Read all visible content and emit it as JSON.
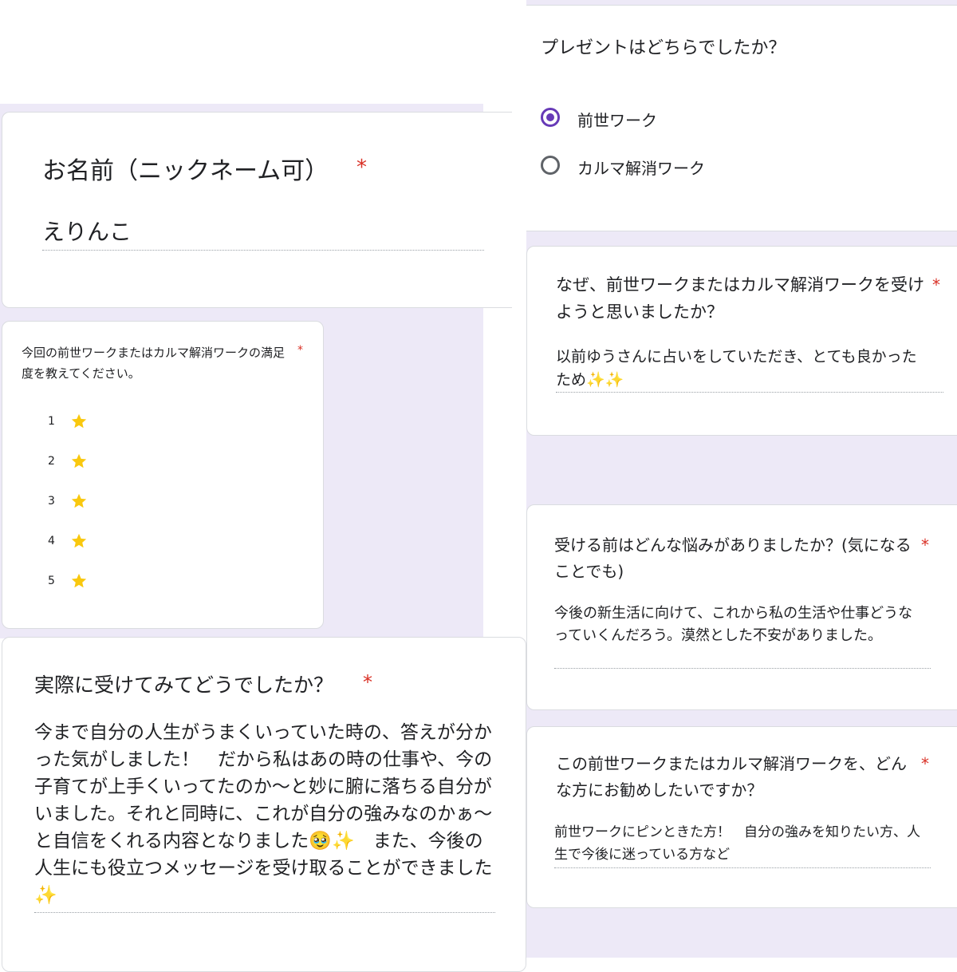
{
  "name_card": {
    "question": "お名前（ニックネーム可）",
    "required_mark": "*",
    "answer": "えりんこ"
  },
  "satisfaction_card": {
    "question": "今回の前世ワークまたはカルマ解消ワークの満足度を教えてください。",
    "required_mark": "*",
    "rows": [
      {
        "label": "1",
        "star_color": "#f9c80e"
      },
      {
        "label": "2",
        "star_color": "#f9c80e"
      },
      {
        "label": "3",
        "star_color": "#f9c80e"
      },
      {
        "label": "4",
        "star_color": "#f9c80e"
      },
      {
        "label": "5",
        "star_color": "#f9c80e"
      }
    ]
  },
  "experience_card": {
    "question": "実際に受けてみてどうでしたか？",
    "required_mark": "*",
    "answer": "今まで自分の人生がうまくいっていた時の、答えが分かった気がしました！　だから私はあの時の仕事や、今の子育てが上手くいってたのか〜と妙に腑に落ちる自分がいました。それと同時に、これが自分の強みなのかぁ〜と自信をくれる内容となりました🥹✨　また、今後の人生にも役立つメッセージを受け取ることができました✨"
  },
  "gift_card": {
    "question": "プレゼントはどちらでしたか？",
    "options": [
      {
        "label": "前世ワーク",
        "selected": true
      },
      {
        "label": "カルマ解消ワーク",
        "selected": false
      }
    ],
    "accent_color": "#673ab7"
  },
  "why_card": {
    "question": "なぜ、前世ワークまたはカルマ解消ワークを受けようと思いましたか？",
    "required_mark": "*",
    "answer": "以前ゆうさんに占いをしていただき、とても良かったため✨✨"
  },
  "worry_card": {
    "question": "受ける前はどんな悩みがありましたか？(気になることでも)",
    "required_mark": "*",
    "answer": "今後の新生活に向けて、これから私の生活や仕事どうなっていくんだろう。漠然とした不安がありました。"
  },
  "recommend_card": {
    "question": "この前世ワークまたはカルマ解消ワークを、どんな方にお勧めしたいですか？",
    "required_mark": "*",
    "answer": "前世ワークにピンときた方！　自分の強みを知りたい方、人生で今後に迷っている方など"
  }
}
